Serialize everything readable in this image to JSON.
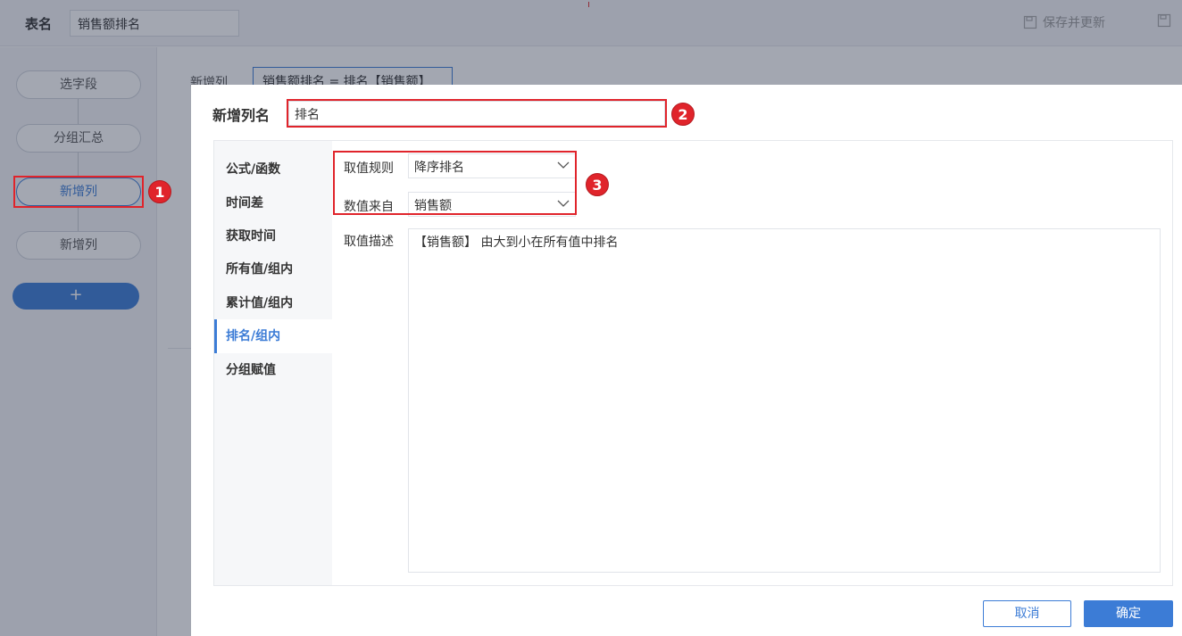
{
  "app": {
    "table_label": "表名",
    "table_name": "销售额排名",
    "save_update_label": "保存并更新"
  },
  "steps": [
    {
      "label": "选字段"
    },
    {
      "label": "分组汇总"
    },
    {
      "label": "新增列"
    },
    {
      "label": "新增列"
    }
  ],
  "add_step_label": "+",
  "main_bg": {
    "label": "新增列",
    "formula": "销售额排名 = 排名【销售额】"
  },
  "annotations": [
    "1",
    "2",
    "3"
  ],
  "dialog": {
    "title": "新增列名",
    "name_value": "排名",
    "side_items": [
      {
        "label": "公式/函数"
      },
      {
        "label": "时间差"
      },
      {
        "label": "获取时间"
      },
      {
        "label": "所有值/组内"
      },
      {
        "label": "累计值/组内"
      },
      {
        "label": "排名/组内"
      },
      {
        "label": "分组赋值"
      }
    ],
    "active_side_index": 5,
    "rule_label": "取值规则",
    "rule_value": "降序排名",
    "source_label": "数值来自",
    "source_value": "销售额",
    "desc_label": "取值描述",
    "desc_value": "【销售额】 由大到小在所有值中排名",
    "cancel_label": "取消",
    "ok_label": "确定"
  },
  "colors": {
    "accent": "#3c7cd6",
    "annotation": "#e0242b"
  }
}
